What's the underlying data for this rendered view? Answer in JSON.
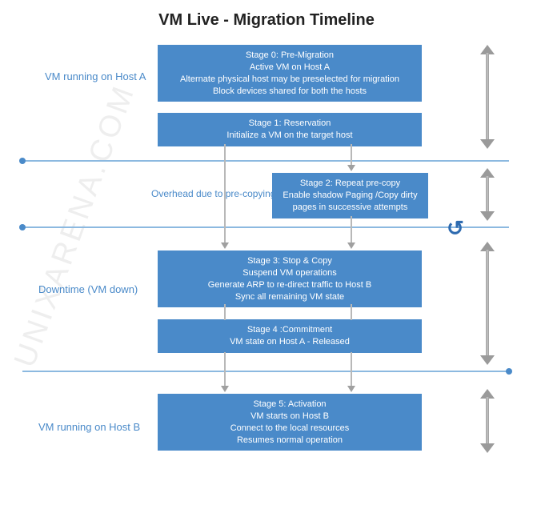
{
  "title": "VM Live - Migration Timeline",
  "watermark": "UNIXARENA.COM",
  "phases": {
    "hostA": "VM running on Host A",
    "overhead": "Overhead due to pre-copying",
    "downtime": "Downtime (VM down)",
    "hostB": "VM running on Host B"
  },
  "stages": {
    "s0": {
      "title": "Stage 0: Pre-Migration",
      "lines": [
        "Active VM on Host A",
        "Alternate physical host may be preselected for migration",
        "Block devices shared for both the hosts"
      ]
    },
    "s1": {
      "title": "Stage 1: Reservation",
      "lines": [
        "Initialize a VM on the target host"
      ]
    },
    "s2": {
      "title": "Stage 2: Repeat pre-copy",
      "lines": [
        "Enable shadow Paging /Copy dirty pages in successive attempts"
      ]
    },
    "s3": {
      "title": "Stage 3: Stop & Copy",
      "lines": [
        "Suspend VM operations",
        "Generate ARP to re-direct traffic to Host B",
        "Sync all remaining VM state"
      ]
    },
    "s4": {
      "title": "Stage 4 :Commitment",
      "lines": [
        "VM state on Host A - Released"
      ]
    },
    "s5": {
      "title": "Stage 5: Activation",
      "lines": [
        "VM starts on Host B",
        "Connect to the local resources",
        "Resumes normal operation"
      ]
    }
  }
}
